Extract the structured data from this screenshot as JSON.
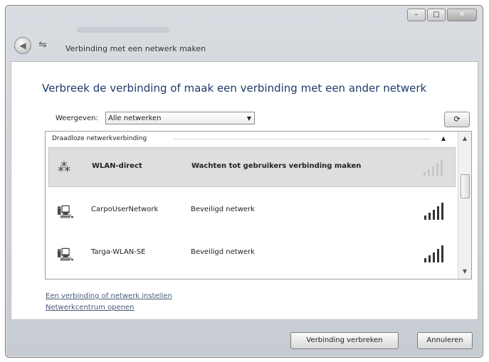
{
  "window": {
    "caption": "Verbinding met een netwerk maken"
  },
  "main": {
    "heading": "Verbreek de verbinding of maak een verbinding met een ander netwerk",
    "show_label": "Weergeven:",
    "show_select_value": "Alle netwerken"
  },
  "list": {
    "group_title": "Draadloze netwerkverbinding",
    "networks": [
      {
        "name": "WLAN-direct",
        "status": "Wachten tot gebruikers verbinding maken",
        "selected": true,
        "icon": "adhoc-network-icon"
      },
      {
        "name": "CarpoUserNetwork",
        "status": "Beveiligd netwerk",
        "selected": false,
        "icon": "secured-network-icon"
      },
      {
        "name": "Targa-WLAN-SE",
        "status": "Beveiligd netwerk",
        "selected": false,
        "icon": "secured-network-icon"
      }
    ]
  },
  "links": {
    "setup": "Een verbinding of netwerk instellen",
    "network_center": "Netwerkcentrum openen"
  },
  "buttons": {
    "disconnect": "Verbinding verbreken",
    "cancel": "Annuleren"
  }
}
